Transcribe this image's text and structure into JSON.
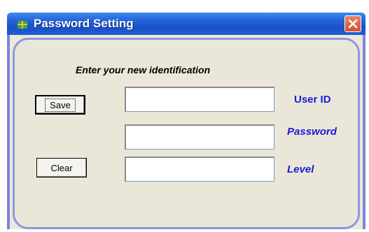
{
  "window": {
    "title": "Password Setting",
    "app_icon": "gift-icon",
    "close_icon": "close-icon",
    "colors": {
      "titlebar": "#2463d8",
      "close": "#d2502e",
      "frame": "#7a86d6",
      "client": "#ece9d8",
      "label": "#1a1ad8"
    }
  },
  "form": {
    "heading": "Enter your new identification",
    "save_label": "Save",
    "clear_label": "Clear",
    "user_id_label": "User ID",
    "password_label": "Password",
    "level_label": "Level",
    "user_id_value": "",
    "password_value": "",
    "level_value": ""
  }
}
